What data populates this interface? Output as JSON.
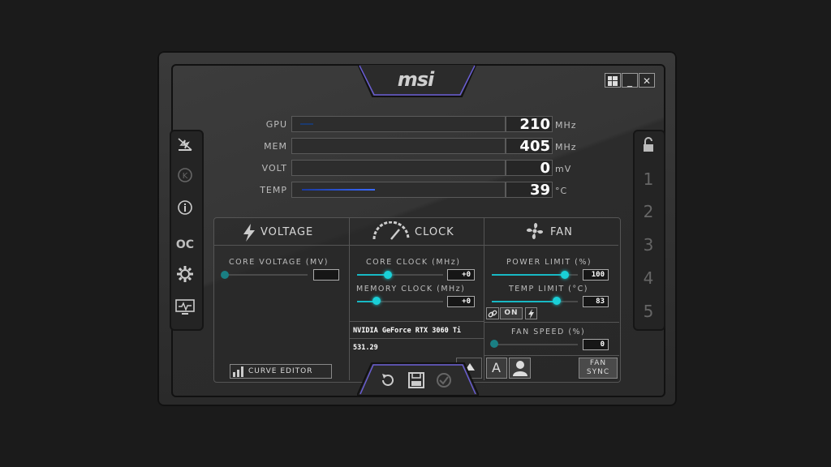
{
  "brand": "msi",
  "window": {
    "win_icon": "windows-icon",
    "minimize": "_",
    "close": "✕"
  },
  "left_sidebar": {
    "icons": [
      "kombustor-icon",
      "k-boost-icon",
      "info-icon",
      "oc-scanner-icon",
      "settings-icon",
      "monitor-icon"
    ],
    "oc_text": "OC"
  },
  "right_sidebar": {
    "lock_icon": "unlock-icon",
    "profiles": [
      "1",
      "2",
      "3",
      "4",
      "5"
    ]
  },
  "monitor": {
    "gpu": {
      "label": "GPU",
      "value": "210",
      "unit": "MHz"
    },
    "mem": {
      "label": "MEM",
      "value": "405",
      "unit": "MHz"
    },
    "volt": {
      "label": "VOLT",
      "value": "0",
      "unit": "mV"
    },
    "temp": {
      "label": "TEMP",
      "value": "39",
      "unit": "°C"
    }
  },
  "voltage": {
    "title": "VOLTAGE",
    "core_voltage_label": "CORE VOLTAGE  (MV)",
    "curve_editor": "CURVE EDITOR"
  },
  "clock": {
    "title": "CLOCK",
    "core_clock_label": "CORE CLOCK (MHz)",
    "core_clock_value": "+0",
    "memory_clock_label": "MEMORY CLOCK (MHz)",
    "memory_clock_value": "+0",
    "gpu_name": "NVIDIA GeForce RTX 3060 Ti",
    "driver": "531.29"
  },
  "fan": {
    "title": "FAN",
    "power_limit_label": "POWER LIMIT (%)",
    "power_limit_value": "100",
    "temp_limit_label": "TEMP LIMIT (°C)",
    "temp_limit_value": "83",
    "link_state": "ON",
    "fan_speed_label": "FAN SPEED (%)",
    "fan_speed_value": "0",
    "auto_label": "A",
    "fan_sync_line1": "FAN",
    "fan_sync_line2": "SYNC"
  },
  "accent_color": "#1ad0d8"
}
